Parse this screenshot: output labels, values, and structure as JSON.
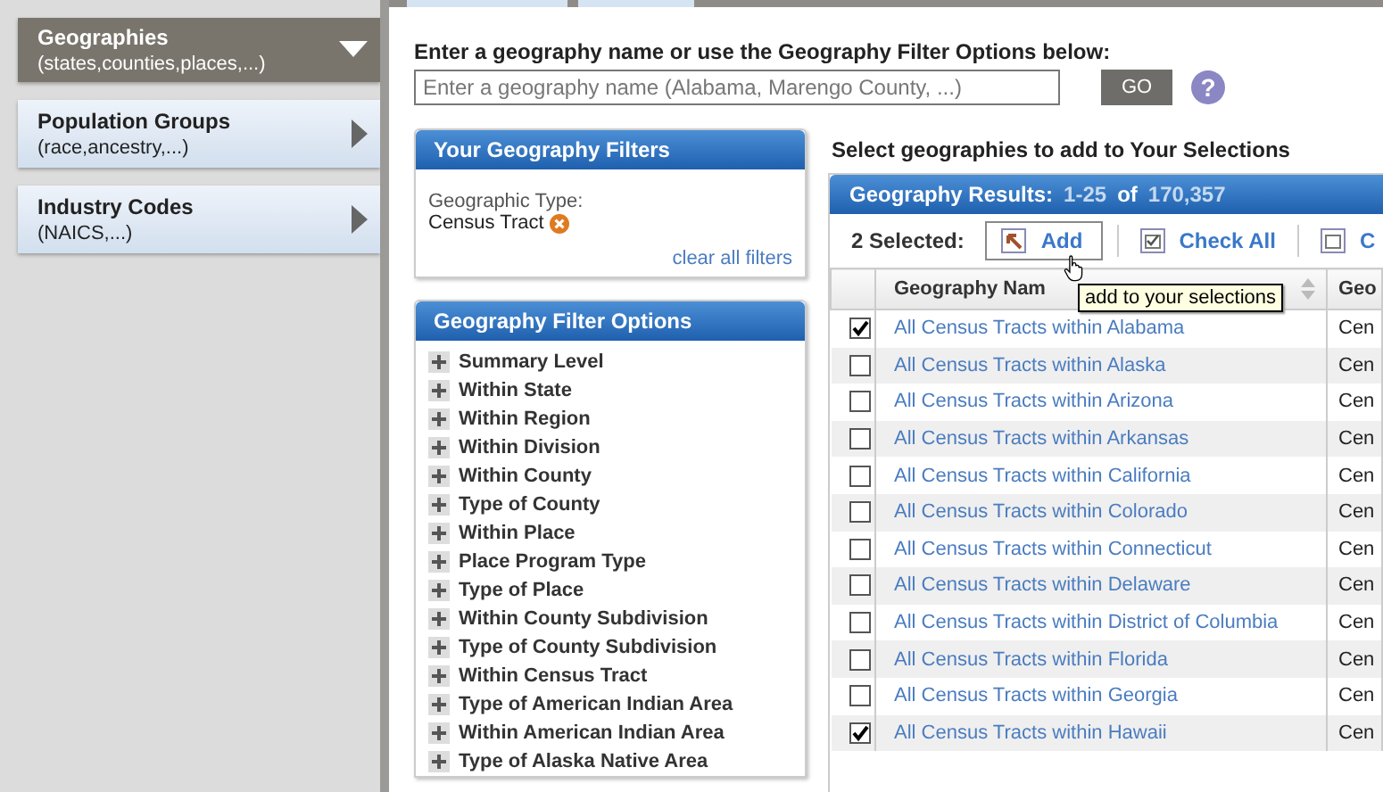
{
  "sidebar": {
    "items": [
      {
        "title": "Geographies",
        "subtitle": "(states,counties,places,...)",
        "expanded": true
      },
      {
        "title": "Population Groups",
        "subtitle": "(race,ancestry,...)",
        "expanded": false
      },
      {
        "title": "Industry Codes",
        "subtitle": "(NAICS,...)",
        "expanded": false
      }
    ]
  },
  "search": {
    "label": "Enter a geography name or use the Geography Filter Options below:",
    "placeholder": "Enter a geography name (Alabama, Marengo County, ...)",
    "button": "GO",
    "help": "?"
  },
  "filters": {
    "title": "Your Geography Filters",
    "type_label": "Geographic Type:",
    "type_value": "Census Tract",
    "clear_link": "clear all filters"
  },
  "filter_options": {
    "title": "Geography Filter Options",
    "items": [
      "Summary Level",
      "Within State",
      "Within Region",
      "Within Division",
      "Within County",
      "Type of County",
      "Within Place",
      "Place Program Type",
      "Type of Place",
      "Within County Subdivision",
      "Type of County Subdivision",
      "Within Census Tract",
      "Type of American Indian Area",
      "Within American Indian Area",
      "Type of Alaska Native Area"
    ]
  },
  "results": {
    "heading": "Select geographies to add to Your Selections",
    "title": "Geography Results:",
    "range": "1-25",
    "of": "of",
    "total": "170,357",
    "selected_count": "2 Selected:",
    "add_button": "Add",
    "check_all_button": "Check All",
    "third_button": "C",
    "tooltip": "add to your selections",
    "columns": [
      "Geography Nam",
      "Geo"
    ],
    "rows": [
      {
        "name": "All Census Tracts within Alabama",
        "type": "Cen",
        "checked": true
      },
      {
        "name": "All Census Tracts within Alaska",
        "type": "Cen",
        "checked": false
      },
      {
        "name": "All Census Tracts within Arizona",
        "type": "Cen",
        "checked": false
      },
      {
        "name": "All Census Tracts within Arkansas",
        "type": "Cen",
        "checked": false
      },
      {
        "name": "All Census Tracts within California",
        "type": "Cen",
        "checked": false
      },
      {
        "name": "All Census Tracts within Colorado",
        "type": "Cen",
        "checked": false
      },
      {
        "name": "All Census Tracts within Connecticut",
        "type": "Cen",
        "checked": false
      },
      {
        "name": "All Census Tracts within Delaware",
        "type": "Cen",
        "checked": false
      },
      {
        "name": "All Census Tracts within District of Columbia",
        "type": "Cen",
        "checked": false
      },
      {
        "name": "All Census Tracts within Florida",
        "type": "Cen",
        "checked": false
      },
      {
        "name": "All Census Tracts within Georgia",
        "type": "Cen",
        "checked": false
      },
      {
        "name": "All Census Tracts within Hawaii",
        "type": "Cen",
        "checked": true
      }
    ]
  }
}
